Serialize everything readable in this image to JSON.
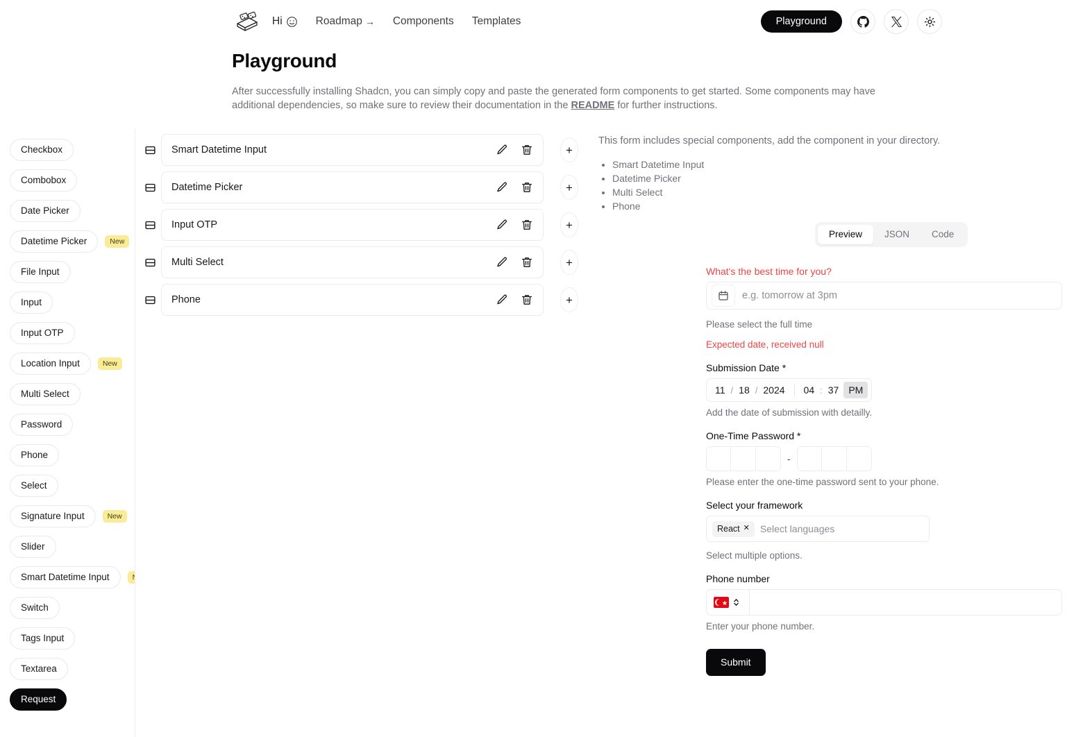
{
  "header": {
    "logo_icon": "package-box-icon",
    "nav": [
      {
        "label": "Hi",
        "icon": "smiley-icon"
      },
      {
        "label": "Roadmap",
        "icon": "arrow-right-icon"
      },
      {
        "label": "Components",
        "icon": ""
      },
      {
        "label": "Templates",
        "icon": ""
      }
    ],
    "playground_button": "Playground",
    "github_icon": "github-icon",
    "x_icon": "x-twitter-icon",
    "theme_icon": "sun-icon"
  },
  "page": {
    "title": "Playground",
    "description_part1": "After successfully installing Shadcn, you can simply copy and paste the generated form components to get started. Some components may have additional dependencies, so make sure to review their documentation in the ",
    "description_link": "README",
    "description_part2": " for further instructions."
  },
  "sidebar": {
    "items": [
      {
        "label": "Checkbox",
        "badge": "",
        "active": false
      },
      {
        "label": "Combobox",
        "badge": "",
        "active": false
      },
      {
        "label": "Date Picker",
        "badge": "",
        "active": false
      },
      {
        "label": "Datetime Picker",
        "badge": "New",
        "active": false
      },
      {
        "label": "File Input",
        "badge": "",
        "active": false
      },
      {
        "label": "Input",
        "badge": "",
        "active": false
      },
      {
        "label": "Input OTP",
        "badge": "",
        "active": false
      },
      {
        "label": "Location Input",
        "badge": "New",
        "active": false
      },
      {
        "label": "Multi Select",
        "badge": "",
        "active": false
      },
      {
        "label": "Password",
        "badge": "",
        "active": false
      },
      {
        "label": "Phone",
        "badge": "",
        "active": false
      },
      {
        "label": "Select",
        "badge": "",
        "active": false
      },
      {
        "label": "Signature Input",
        "badge": "New",
        "active": false
      },
      {
        "label": "Slider",
        "badge": "",
        "active": false
      },
      {
        "label": "Smart Datetime Input",
        "badge": "New",
        "active": false
      },
      {
        "label": "Switch",
        "badge": "",
        "active": false
      },
      {
        "label": "Tags Input",
        "badge": "",
        "active": false
      },
      {
        "label": "Textarea",
        "badge": "",
        "active": false
      },
      {
        "label": "Request",
        "badge": "",
        "active": true
      }
    ]
  },
  "builder": {
    "rows": [
      {
        "label": "Smart Datetime Input"
      },
      {
        "label": "Datetime Picker"
      },
      {
        "label": "Input OTP"
      },
      {
        "label": "Multi Select"
      },
      {
        "label": "Phone"
      }
    ],
    "grip_icon": "rows-grip-icon",
    "edit_icon": "pencil-icon",
    "delete_icon": "trash-icon",
    "add_icon": "plus-icon",
    "add_label": "+"
  },
  "special": {
    "note": "This form includes special components, add the component in your directory.",
    "items": [
      "Smart Datetime Input",
      "Datetime Picker",
      "Multi Select",
      "Phone"
    ]
  },
  "tabs": [
    {
      "label": "Preview",
      "active": true
    },
    {
      "label": "JSON",
      "active": false
    },
    {
      "label": "Code",
      "active": false
    }
  ],
  "form": {
    "smart_datetime": {
      "label": "What's the best time for you?",
      "placeholder": "e.g. tomorrow at 3pm",
      "help": "Please select the full time",
      "error": "Expected date, received null",
      "calendar_icon": "calendar-icon"
    },
    "submission_date": {
      "label": "Submission Date",
      "required_mark": "*",
      "month": "11",
      "day": "18",
      "year": "2024",
      "hour": "04",
      "minute": "37",
      "meridiem": "PM",
      "date_sep": "/",
      "time_sep": ":",
      "help": "Add the date of submission with detailly."
    },
    "otp": {
      "label": "One-Time Password",
      "required_mark": "*",
      "separator": "-",
      "group1": [
        "",
        "",
        ""
      ],
      "group2": [
        "",
        "",
        ""
      ],
      "help": "Please enter the one-time password sent to your phone."
    },
    "framework": {
      "label": "Select your framework",
      "selected": [
        "React"
      ],
      "remove_icon": "close-x-icon",
      "placeholder": "Select languages",
      "help": "Select multiple options."
    },
    "phone": {
      "label": "Phone number",
      "country_flag": "turkey-flag-icon",
      "chevron_icon": "chevron-up-down-icon",
      "value": "",
      "help": "Enter your phone number."
    },
    "submit_label": "Submit"
  },
  "colors": {
    "accent_dark": "#09090b",
    "badge_new_bg": "#faeb96",
    "error": "#ef4444",
    "muted": "#71717a",
    "flag_red": "#e30a17"
  }
}
